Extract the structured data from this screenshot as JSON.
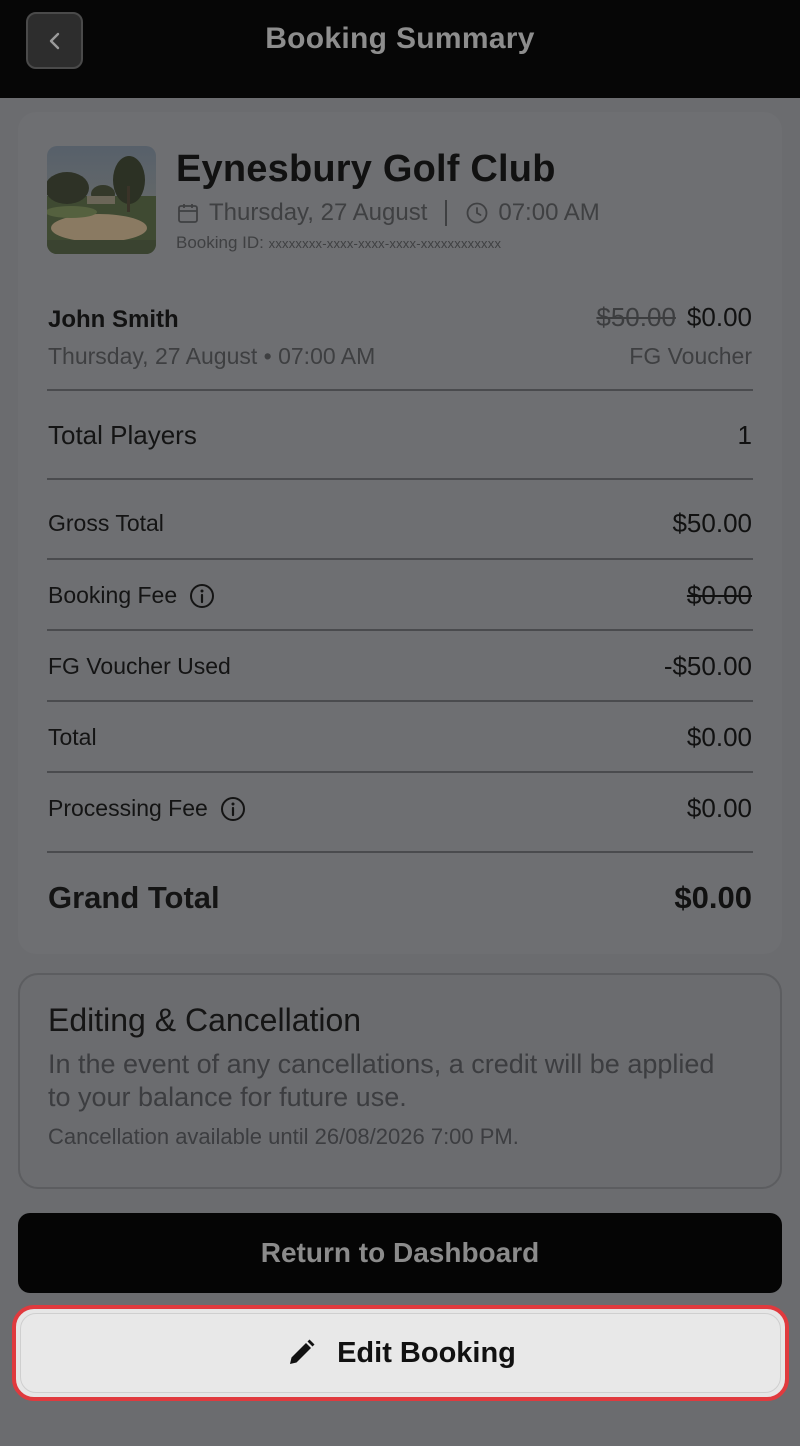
{
  "header": {
    "title": "Booking Summary",
    "back_icon": "chevron-left-icon"
  },
  "course": {
    "name": "Eynesbury Golf Club",
    "date": "Thursday, 27 August",
    "time": "07:00 AM",
    "booking_id_label": "Booking ID:",
    "booking_id_value": "xxxxxxxx-xxxx-xxxx-xxxx-xxxxxxxxxxxx"
  },
  "player": {
    "name": "John Smith",
    "details": "Thursday, 27 August • 07:00 AM",
    "original_price": "$50.00",
    "price": "$0.00",
    "discount_label": "FG Voucher"
  },
  "summary": {
    "total_players_label": "Total Players",
    "total_players_value": "1",
    "gross_total_label": "Gross Total",
    "gross_total_value": "$50.00",
    "booking_fee_label": "Booking Fee",
    "booking_fee_value": "$0.00",
    "voucher_label": "FG Voucher Used",
    "voucher_value": "-$50.00",
    "total_label": "Total",
    "total_value": "$0.00",
    "processing_fee_label": "Processing Fee",
    "processing_fee_value": "$0.00",
    "grand_total_label": "Grand Total",
    "grand_total_value": "$0.00"
  },
  "editing": {
    "title": "Editing & Cancellation",
    "body": "In the event of any cancellations, a credit will be applied to your balance for future use.",
    "deadline": "Cancellation available until 26/08/2026 7:00 PM."
  },
  "actions": {
    "dashboard_label": "Return to Dashboard",
    "edit_label": "Edit Booking"
  },
  "colors": {
    "overlay": "#6b6c6f",
    "header_bg": "#060606",
    "highlight": "#e03a3e"
  }
}
